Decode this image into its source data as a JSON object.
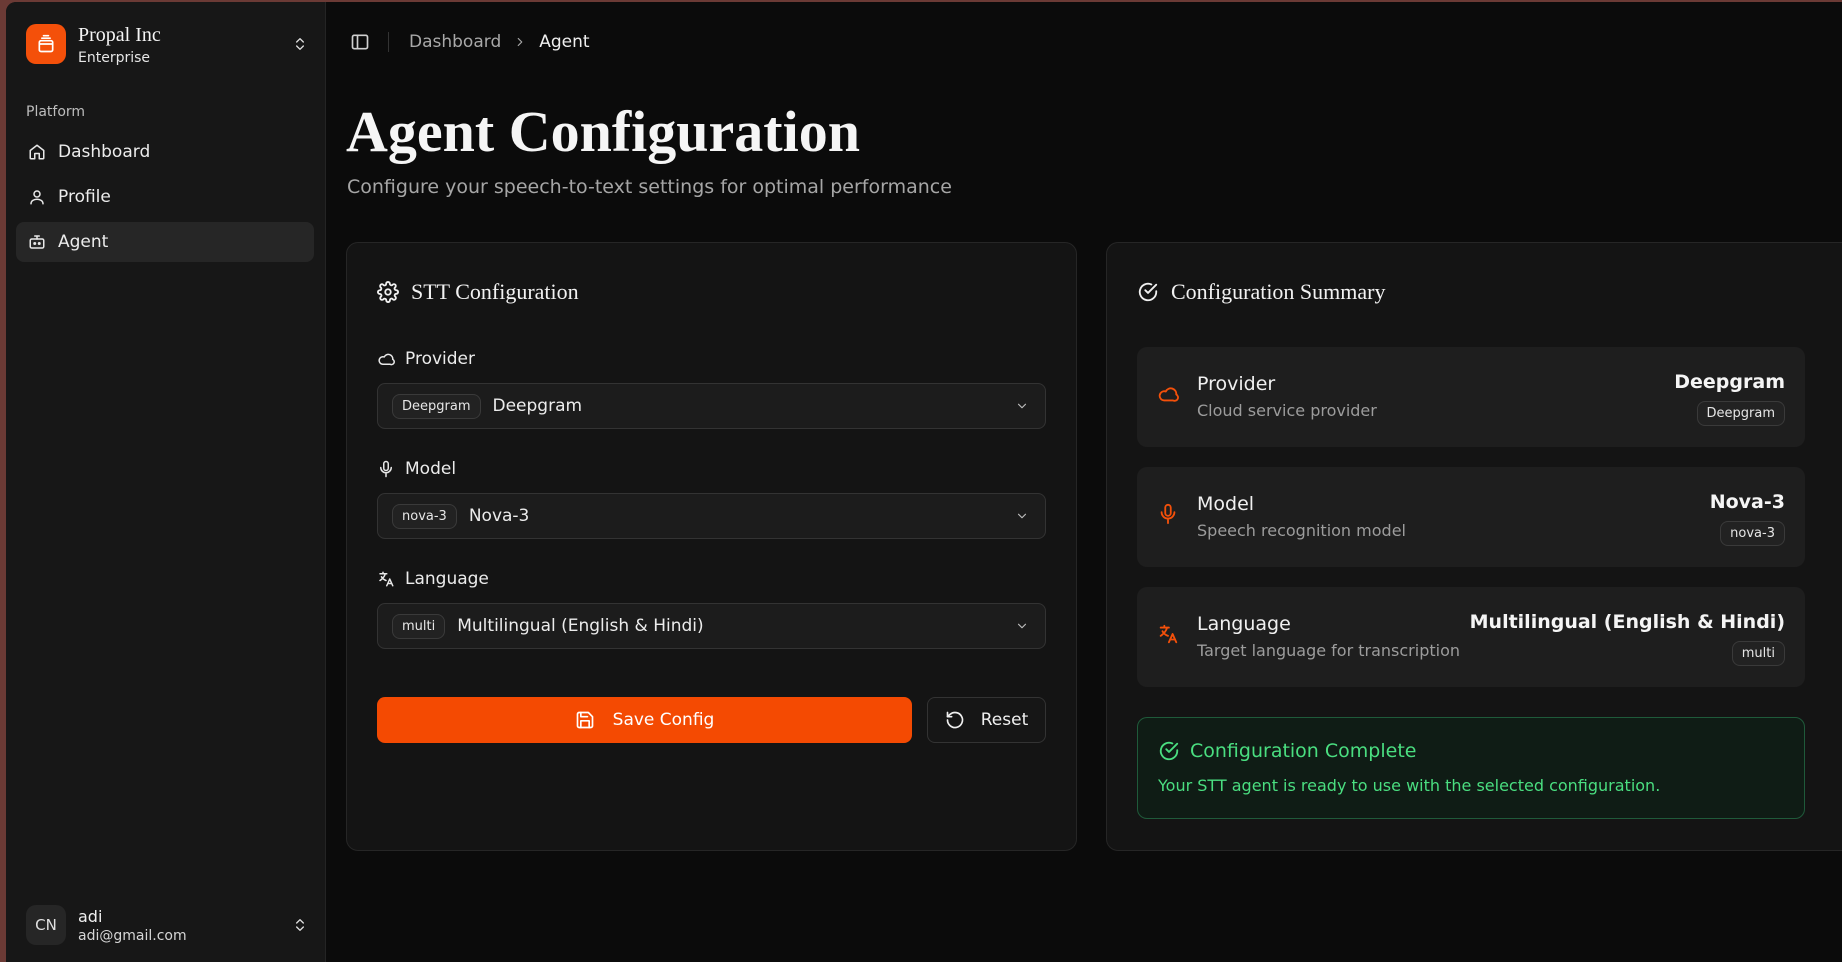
{
  "org": {
    "name": "Propal Inc",
    "plan": "Enterprise",
    "icon": "stack-icon"
  },
  "sidebar": {
    "section_label": "Platform",
    "items": [
      {
        "label": "Dashboard",
        "icon": "home-icon",
        "active": false
      },
      {
        "label": "Profile",
        "icon": "user-icon",
        "active": false
      },
      {
        "label": "Agent",
        "icon": "bot-icon",
        "active": true
      }
    ]
  },
  "user": {
    "initials": "CN",
    "name": "adi",
    "email": "adi@gmail.com"
  },
  "breadcrumb": {
    "items": [
      "Dashboard",
      "Agent"
    ]
  },
  "page": {
    "title": "Agent Configuration",
    "subtitle": "Configure your speech-to-text settings for optimal performance"
  },
  "stt": {
    "title": "STT Configuration",
    "provider": {
      "label": "Provider",
      "badge": "Deepgram",
      "value": "Deepgram"
    },
    "model": {
      "label": "Model",
      "badge": "nova-3",
      "value": "Nova-3"
    },
    "language": {
      "label": "Language",
      "badge": "multi",
      "value": "Multilingual (English & Hindi)"
    },
    "save_label": "Save Config",
    "reset_label": "Reset"
  },
  "summary": {
    "title": "Configuration Summary",
    "items": [
      {
        "name": "Provider",
        "desc": "Cloud service provider",
        "value": "Deepgram",
        "badge": "Deepgram",
        "icon": "cloud-icon"
      },
      {
        "name": "Model",
        "desc": "Speech recognition model",
        "value": "Nova-3",
        "badge": "nova-3",
        "icon": "mic-icon"
      },
      {
        "name": "Language",
        "desc": "Target language for transcription",
        "value": "Multilingual (English & Hindi)",
        "badge": "multi",
        "icon": "translate-icon"
      }
    ],
    "complete": {
      "title": "Configuration Complete",
      "text": "Your STT agent is ready to use with the selected configuration."
    }
  },
  "colors": {
    "accent": "#f44a02",
    "success": "#4ade80"
  }
}
